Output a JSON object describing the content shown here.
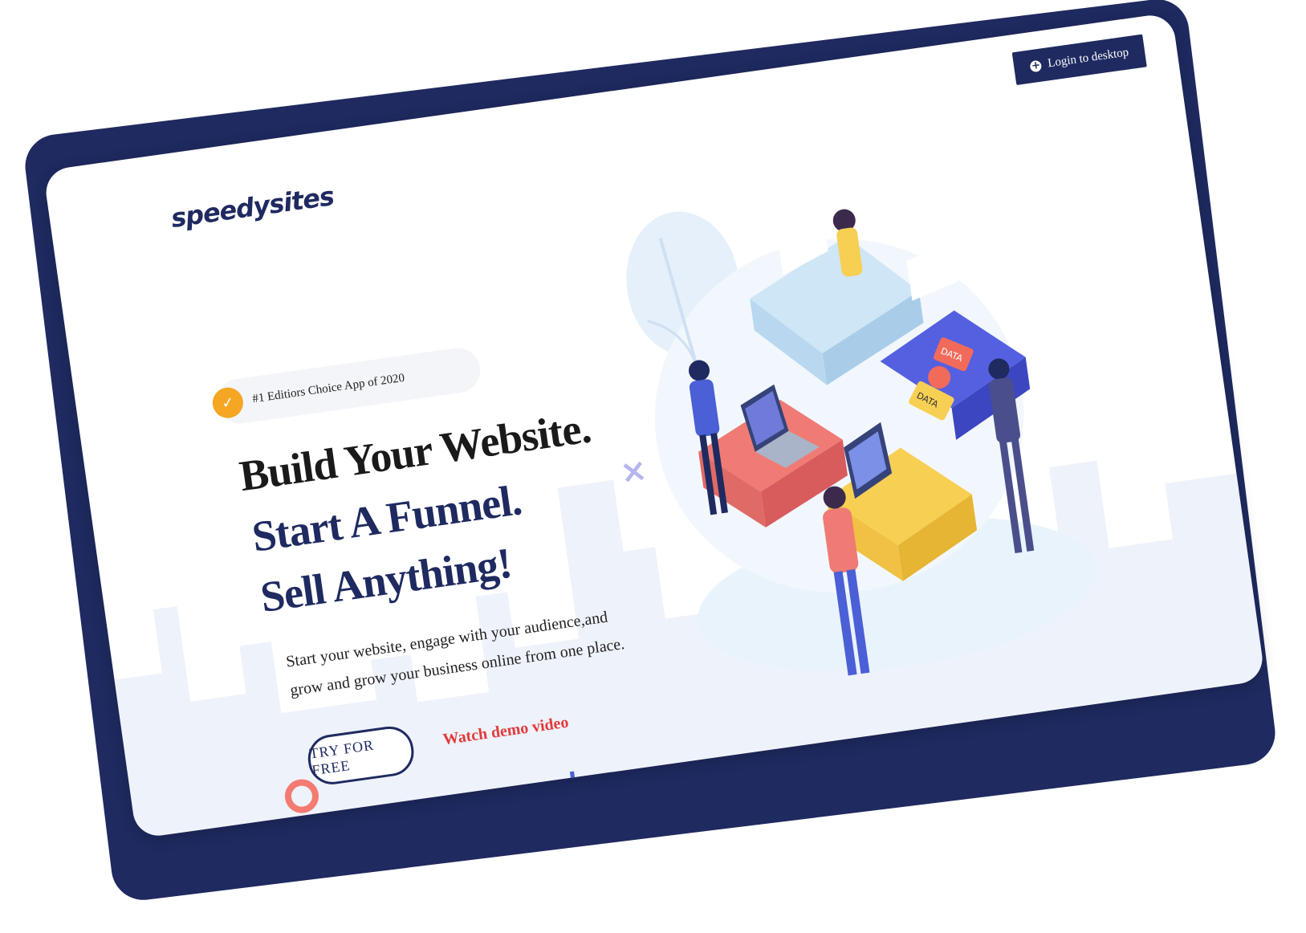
{
  "brand": {
    "logo_text": "speedysites",
    "navy": "#1e2a60",
    "accent_red": "#e23b3b",
    "badge_orange": "#f5a623"
  },
  "header": {
    "login_label": "Login to desktop",
    "login_icon": "plus-circle-icon"
  },
  "hero": {
    "badge_text": "#1 Editiors Choice App of 2020",
    "badge_icon": "check-badge-icon",
    "headline_line1": "Build Your Website.",
    "headline_line2": "Start A Funnel. Sell Anything!",
    "description": "Start your website, engage with your audience,and grow and grow your business online from one place.",
    "cta_primary": "TRY FOR FREE",
    "cta_secondary": "Watch demo video"
  },
  "illustration": {
    "labels": [
      "DATA",
      "DATA"
    ],
    "icon": "puzzle-team-illustration"
  }
}
